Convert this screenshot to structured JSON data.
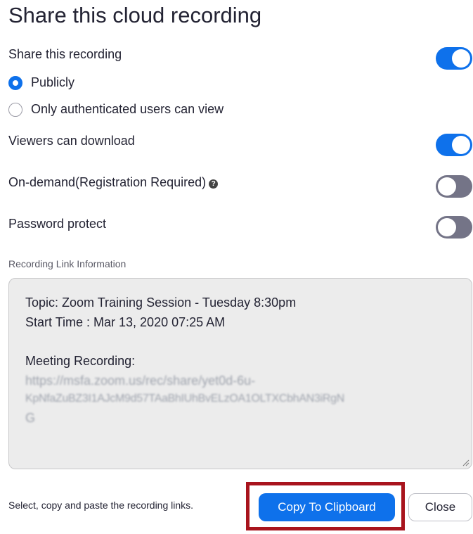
{
  "dialog": {
    "title": "Share this cloud recording",
    "share_recording_label": "Share this recording",
    "share_recording_on": true,
    "radio_publicly": "Publicly",
    "radio_authenticated": "Only authenticated users can view",
    "selected_visibility": "Publicly",
    "viewers_download_label": "Viewers can download",
    "viewers_download_on": true,
    "on_demand_label": "On-demand(Registration Required)",
    "on_demand_on": false,
    "password_label": "Password protect",
    "password_on": false
  },
  "link_info": {
    "section_label": "Recording Link Information",
    "topic_line": "Topic: Zoom Training Session - Tuesday 8:30pm",
    "start_time_line": "Start Time : Mar 13, 2020 07:25 AM",
    "meeting_recording_label": "Meeting Recording:",
    "url_line_1": "https://msfa.zoom.us/rec/share/yet0d-6u-",
    "url_line_2": "KpNfaZuBZ3I1AJcM9d57TAaBhIUhBvELzOA1OLTXCbhAN3iRgN",
    "url_line_3": "G"
  },
  "footer": {
    "instruction": "Select, copy and paste the recording links.",
    "copy_button": "Copy To Clipboard",
    "close_button": "Close"
  },
  "colors": {
    "accent": "#0e71eb",
    "toggle_off": "#747487",
    "highlight_box": "#a8141d"
  }
}
